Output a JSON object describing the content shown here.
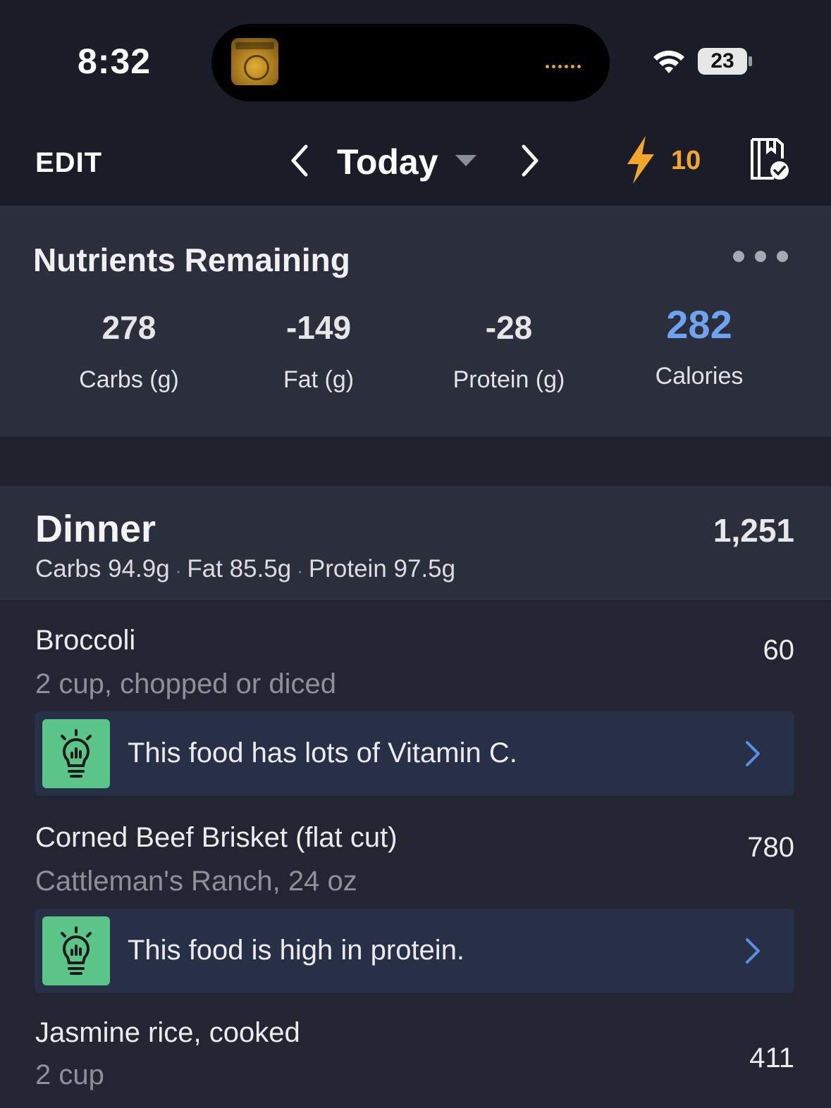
{
  "status_bar": {
    "time": "8:32",
    "battery": "23",
    "icons": [
      "album-art-icon",
      "wifi-icon",
      "battery-icon"
    ]
  },
  "nav": {
    "edit_label": "EDIT",
    "date_label": "Today",
    "streak_count": "10",
    "icons": [
      "chevron-left-icon",
      "chevron-down-icon",
      "chevron-right-icon",
      "lightning-icon",
      "plan-check-icon"
    ],
    "streak_color": "#f4a62a"
  },
  "nutrients_remaining": {
    "title": "Nutrients Remaining",
    "stats": [
      {
        "value": "278",
        "label": "Carbs (g)"
      },
      {
        "value": "-149",
        "label": "Fat (g)"
      },
      {
        "value": "-28",
        "label": "Protein (g)"
      },
      {
        "value": "282",
        "label": "Calories"
      }
    ],
    "calories_color": "#6fa3f2"
  },
  "meal": {
    "name": "Dinner",
    "calories": "1,251",
    "carbs": "Carbs 94.9g",
    "fat": "Fat 85.5g",
    "protein": "Protein 97.5g",
    "separator": "·",
    "foods": [
      {
        "name": "Broccoli",
        "serving": "2 cup, chopped or diced",
        "calories": "60",
        "insight": "This food has lots of Vitamin C."
      },
      {
        "name": "Corned Beef Brisket (flat cut)",
        "serving": "Cattleman's Ranch, 24 oz",
        "calories": "780",
        "insight": "This food is high in protein."
      },
      {
        "name": "Jasmine rice, cooked",
        "serving": "2 cup",
        "calories": "411"
      }
    ]
  },
  "colors": {
    "background": "#232632",
    "card": "#2b2e3b",
    "insight_bg": "#283047",
    "insight_icon_bg": "#5bc489",
    "link_blue": "#5a8fe6"
  }
}
